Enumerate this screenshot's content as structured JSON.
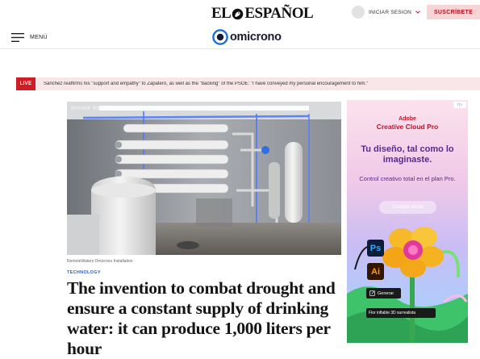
{
  "header": {
    "brand_left": "EL",
    "brand_right": "ESPAÑOL",
    "login_label": "INICIAR SESION",
    "subscribe_label": "SUSCRÍBETE"
  },
  "nav": {
    "menu_label": "MENÚ",
    "section_name": "omicrono"
  },
  "ticker": {
    "badge": "LIVE",
    "text": "Sánchez reaffirms his \"support and empathy\" to Zapatero, as well as the \"backing\" of the PSOE: \"I have conveyed my personal encouragement to him.\""
  },
  "article": {
    "photo_watermark": "Remote Waters",
    "caption": "RemoteWaters Omicrono Installation",
    "kicker": "TECHNOLOGY",
    "headline": "The invention to combat drought and ensure a constant supply of drinking water: it can produce 1,000 liters per hour"
  },
  "ad": {
    "choices_label": "i ▷",
    "brand_line1": "Adobe",
    "brand_line2": "Creative Cloud Pro",
    "headline": "Tu diseño, tal como lo imaginaste.",
    "subtext": "Control creativo total en el plan Pro.",
    "cta_label": "Compra ahora",
    "tool_ps": "Ps",
    "tool_ai": "Ai",
    "tool_generate": "Generar",
    "prompt_text": "Flor inflable 3D surrealista",
    "colors": {
      "brand_red": "#c0142a",
      "headline_purple": "#5a2a8a"
    }
  },
  "colors": {
    "subscribe_bg": "#f7d5d7",
    "subscribe_text": "#b3101c",
    "live_red": "#d01c25",
    "ticker_bg": "#f8e6e8",
    "kicker_blue": "#2b5fc7"
  }
}
